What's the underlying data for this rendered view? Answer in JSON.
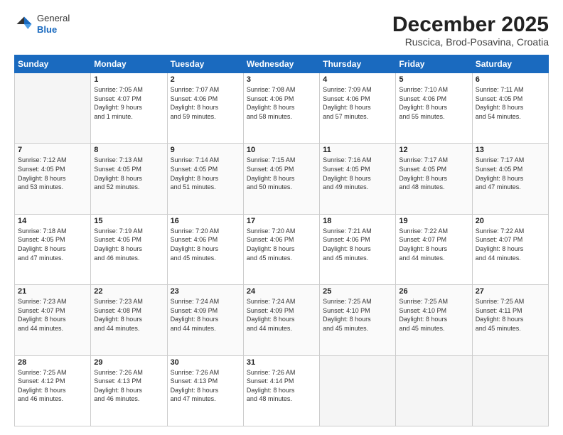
{
  "header": {
    "logo_general": "General",
    "logo_blue": "Blue",
    "month_title": "December 2025",
    "location": "Ruscica, Brod-Posavina, Croatia"
  },
  "weekdays": [
    "Sunday",
    "Monday",
    "Tuesday",
    "Wednesday",
    "Thursday",
    "Friday",
    "Saturday"
  ],
  "weeks": [
    [
      {
        "day": "",
        "text": ""
      },
      {
        "day": "1",
        "text": "Sunrise: 7:05 AM\nSunset: 4:07 PM\nDaylight: 9 hours\nand 1 minute."
      },
      {
        "day": "2",
        "text": "Sunrise: 7:07 AM\nSunset: 4:06 PM\nDaylight: 8 hours\nand 59 minutes."
      },
      {
        "day": "3",
        "text": "Sunrise: 7:08 AM\nSunset: 4:06 PM\nDaylight: 8 hours\nand 58 minutes."
      },
      {
        "day": "4",
        "text": "Sunrise: 7:09 AM\nSunset: 4:06 PM\nDaylight: 8 hours\nand 57 minutes."
      },
      {
        "day": "5",
        "text": "Sunrise: 7:10 AM\nSunset: 4:06 PM\nDaylight: 8 hours\nand 55 minutes."
      },
      {
        "day": "6",
        "text": "Sunrise: 7:11 AM\nSunset: 4:05 PM\nDaylight: 8 hours\nand 54 minutes."
      }
    ],
    [
      {
        "day": "7",
        "text": "Sunrise: 7:12 AM\nSunset: 4:05 PM\nDaylight: 8 hours\nand 53 minutes."
      },
      {
        "day": "8",
        "text": "Sunrise: 7:13 AM\nSunset: 4:05 PM\nDaylight: 8 hours\nand 52 minutes."
      },
      {
        "day": "9",
        "text": "Sunrise: 7:14 AM\nSunset: 4:05 PM\nDaylight: 8 hours\nand 51 minutes."
      },
      {
        "day": "10",
        "text": "Sunrise: 7:15 AM\nSunset: 4:05 PM\nDaylight: 8 hours\nand 50 minutes."
      },
      {
        "day": "11",
        "text": "Sunrise: 7:16 AM\nSunset: 4:05 PM\nDaylight: 8 hours\nand 49 minutes."
      },
      {
        "day": "12",
        "text": "Sunrise: 7:17 AM\nSunset: 4:05 PM\nDaylight: 8 hours\nand 48 minutes."
      },
      {
        "day": "13",
        "text": "Sunrise: 7:17 AM\nSunset: 4:05 PM\nDaylight: 8 hours\nand 47 minutes."
      }
    ],
    [
      {
        "day": "14",
        "text": "Sunrise: 7:18 AM\nSunset: 4:05 PM\nDaylight: 8 hours\nand 47 minutes."
      },
      {
        "day": "15",
        "text": "Sunrise: 7:19 AM\nSunset: 4:05 PM\nDaylight: 8 hours\nand 46 minutes."
      },
      {
        "day": "16",
        "text": "Sunrise: 7:20 AM\nSunset: 4:06 PM\nDaylight: 8 hours\nand 45 minutes."
      },
      {
        "day": "17",
        "text": "Sunrise: 7:20 AM\nSunset: 4:06 PM\nDaylight: 8 hours\nand 45 minutes."
      },
      {
        "day": "18",
        "text": "Sunrise: 7:21 AM\nSunset: 4:06 PM\nDaylight: 8 hours\nand 45 minutes."
      },
      {
        "day": "19",
        "text": "Sunrise: 7:22 AM\nSunset: 4:07 PM\nDaylight: 8 hours\nand 44 minutes."
      },
      {
        "day": "20",
        "text": "Sunrise: 7:22 AM\nSunset: 4:07 PM\nDaylight: 8 hours\nand 44 minutes."
      }
    ],
    [
      {
        "day": "21",
        "text": "Sunrise: 7:23 AM\nSunset: 4:07 PM\nDaylight: 8 hours\nand 44 minutes."
      },
      {
        "day": "22",
        "text": "Sunrise: 7:23 AM\nSunset: 4:08 PM\nDaylight: 8 hours\nand 44 minutes."
      },
      {
        "day": "23",
        "text": "Sunrise: 7:24 AM\nSunset: 4:09 PM\nDaylight: 8 hours\nand 44 minutes."
      },
      {
        "day": "24",
        "text": "Sunrise: 7:24 AM\nSunset: 4:09 PM\nDaylight: 8 hours\nand 44 minutes."
      },
      {
        "day": "25",
        "text": "Sunrise: 7:25 AM\nSunset: 4:10 PM\nDaylight: 8 hours\nand 45 minutes."
      },
      {
        "day": "26",
        "text": "Sunrise: 7:25 AM\nSunset: 4:10 PM\nDaylight: 8 hours\nand 45 minutes."
      },
      {
        "day": "27",
        "text": "Sunrise: 7:25 AM\nSunset: 4:11 PM\nDaylight: 8 hours\nand 45 minutes."
      }
    ],
    [
      {
        "day": "28",
        "text": "Sunrise: 7:25 AM\nSunset: 4:12 PM\nDaylight: 8 hours\nand 46 minutes."
      },
      {
        "day": "29",
        "text": "Sunrise: 7:26 AM\nSunset: 4:13 PM\nDaylight: 8 hours\nand 46 minutes."
      },
      {
        "day": "30",
        "text": "Sunrise: 7:26 AM\nSunset: 4:13 PM\nDaylight: 8 hours\nand 47 minutes."
      },
      {
        "day": "31",
        "text": "Sunrise: 7:26 AM\nSunset: 4:14 PM\nDaylight: 8 hours\nand 48 minutes."
      },
      {
        "day": "",
        "text": ""
      },
      {
        "day": "",
        "text": ""
      },
      {
        "day": "",
        "text": ""
      }
    ]
  ]
}
